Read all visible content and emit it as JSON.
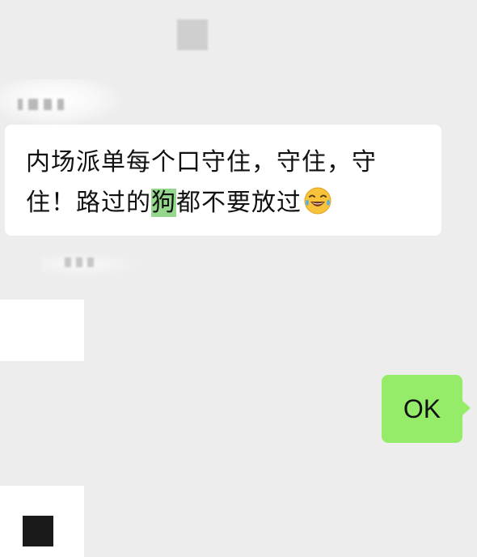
{
  "messages": {
    "incoming": {
      "text_part1": "内场派单每个口守住，守住，守住！路过的",
      "highlighted_text": "狗",
      "text_part2": "都不要放过",
      "emoji": "tears-of-joy-emoji-icon",
      "bubble_color": "#ffffff",
      "highlight_color": "#95d78c"
    },
    "outgoing": {
      "text": "OK",
      "bubble_color": "#95ec69"
    }
  },
  "colors": {
    "background": "#ededed",
    "text": "#111111"
  }
}
